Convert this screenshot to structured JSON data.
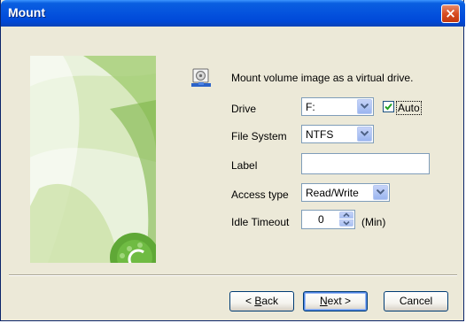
{
  "window": {
    "title": "Mount"
  },
  "content": {
    "heading": "Mount volume image as a virtual drive.",
    "drive": {
      "label": "Drive",
      "value": "F:",
      "auto_label": "Auto",
      "auto_checked": true
    },
    "file_system": {
      "label": "File System",
      "value": "NTFS"
    },
    "volume_label": {
      "label": "Label",
      "value": ""
    },
    "access_type": {
      "label": "Access type",
      "value": "Read/Write"
    },
    "idle_timeout": {
      "label": "Idle Timeout",
      "value": "0",
      "unit": "(Min)"
    }
  },
  "buttons": {
    "back": {
      "mnemonic": "B",
      "pre": "< ",
      "rest": "ack"
    },
    "next": {
      "mnemonic": "N",
      "rest": "ext >"
    },
    "cancel": "Cancel"
  },
  "colors": {
    "titlebar": "#0554de",
    "dialog_bg": "#ece9d8",
    "close": "#d84d23"
  },
  "icons": {
    "close": "close-icon",
    "drive": "disk-drive-icon",
    "dropdown": "chevron-down-icon"
  }
}
